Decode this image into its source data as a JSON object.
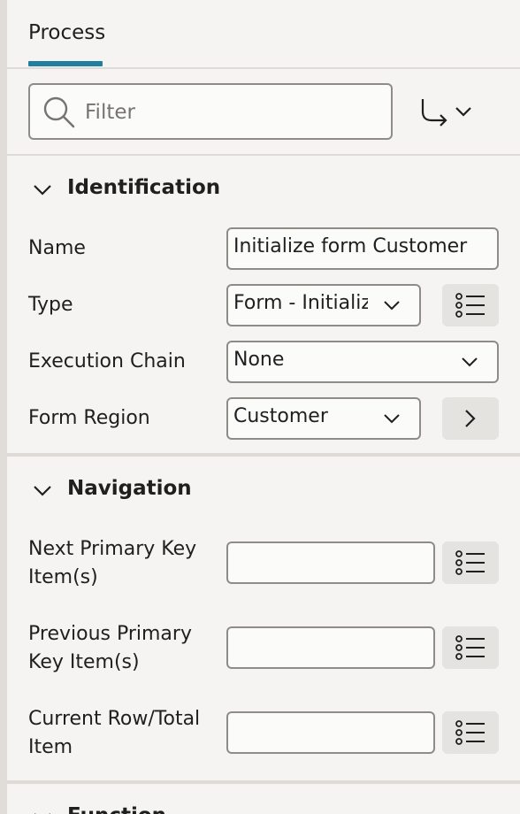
{
  "tabs": [
    {
      "label": "Process"
    }
  ],
  "toolbar": {
    "filter_placeholder": "Filter",
    "goto_icon": "arrow-goto-icon"
  },
  "identification": {
    "title": "Identification",
    "name_label": "Name",
    "name_value": "Initialize form Customer",
    "type_label": "Type",
    "type_value": "Form - Initialize",
    "execution_chain_label": "Execution Chain",
    "execution_chain_value": "None",
    "form_region_label": "Form Region",
    "form_region_value": "Customer"
  },
  "navigation": {
    "title": "Navigation",
    "next_pk_label": "Next Primary Key Item(s)",
    "next_pk_value": "",
    "prev_pk_label": "Previous Primary Key Item(s)",
    "prev_pk_value": "",
    "current_row_label": "Current Row/Total Item",
    "current_row_value": ""
  },
  "next_section": {
    "title": "Function"
  },
  "colors": {
    "accent": "#227e9e",
    "background": "#f5f4f2",
    "border": "#8f8c88"
  }
}
